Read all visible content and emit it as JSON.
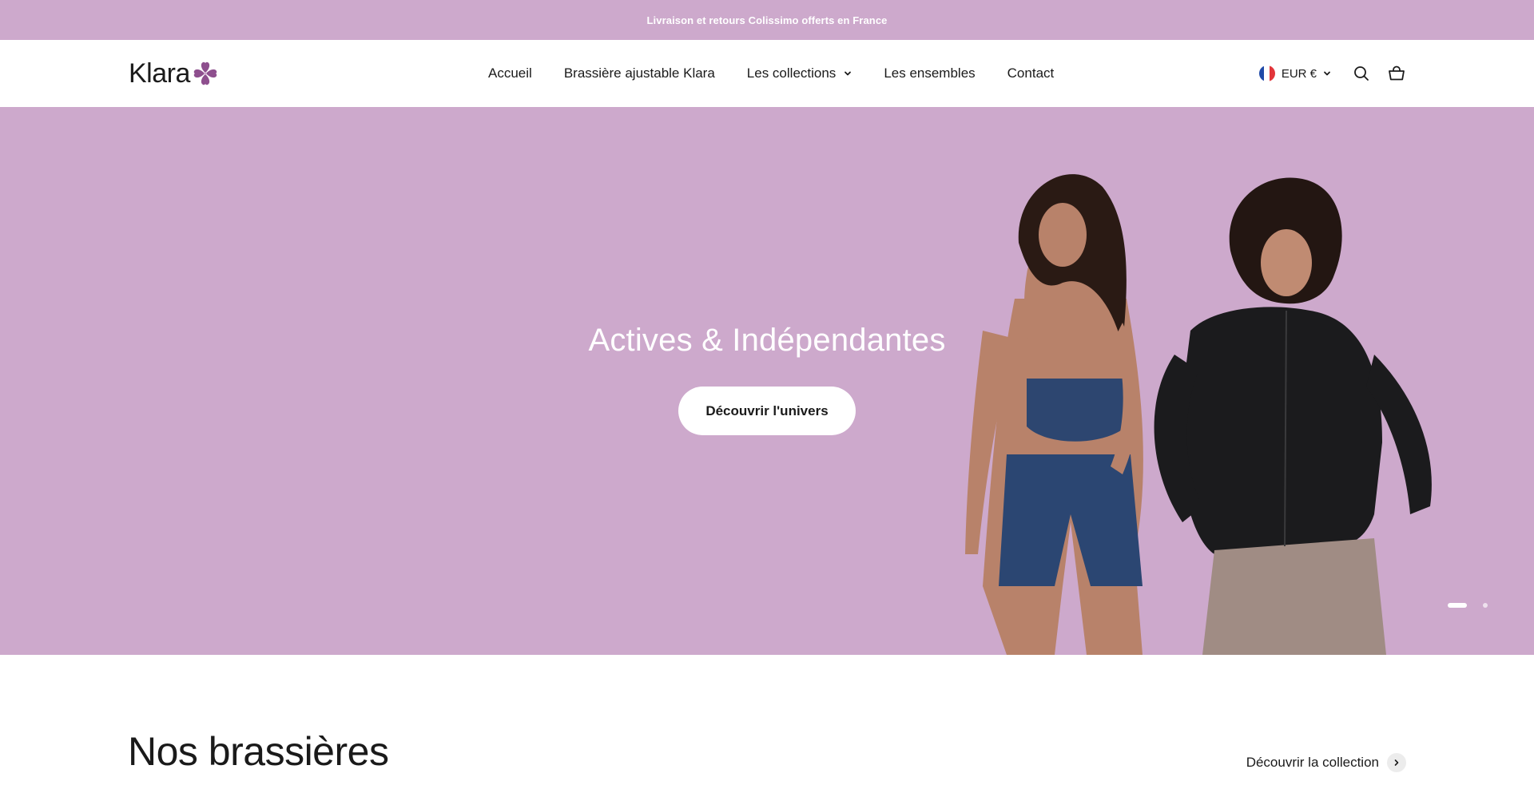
{
  "announcement": {
    "text": "Livraison et retours Colissimo offerts en France"
  },
  "header": {
    "logo_text": "Klara",
    "logo_icon": "flower-icon",
    "nav": [
      {
        "label": "Accueil"
      },
      {
        "label": "Brassière ajustable Klara"
      },
      {
        "label": "Les collections",
        "has_dropdown": true
      },
      {
        "label": "Les ensembles"
      },
      {
        "label": "Contact"
      }
    ],
    "currency": {
      "label": "EUR €",
      "flag": "france-flag-icon"
    },
    "icons": [
      "search-icon",
      "cart-icon"
    ]
  },
  "hero": {
    "title": "Actives & Indépendantes",
    "cta_label": "Découvrir l'univers",
    "slides_total": 2,
    "active_slide": 1
  },
  "section": {
    "title": "Nos brassières",
    "link_label": "Découvrir la collection"
  },
  "colors": {
    "brand_lilac": "#cda9cc",
    "logo_purple": "#8e4f8e",
    "text": "#1a1a1a",
    "white": "#ffffff"
  }
}
